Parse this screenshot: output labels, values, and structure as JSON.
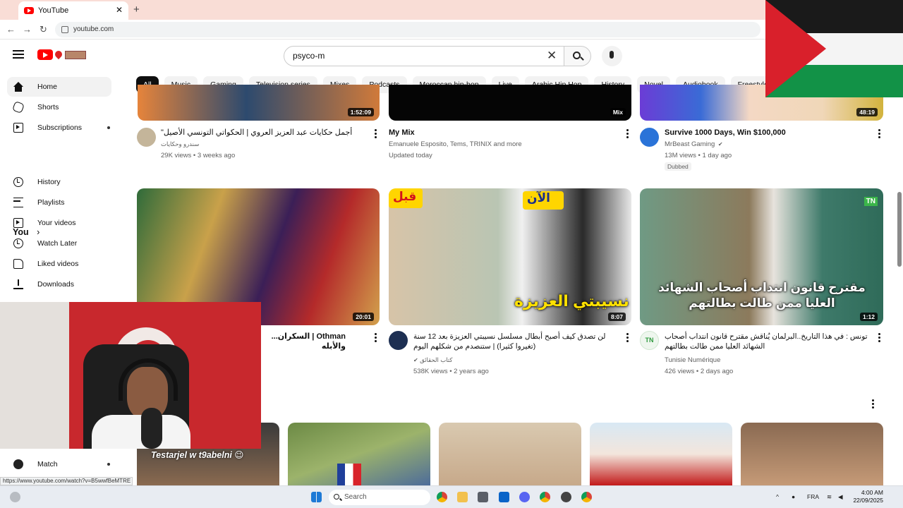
{
  "browser": {
    "tab_title": "YouTube",
    "tab_close": "✕",
    "new_tab": "+",
    "url": "youtube.com",
    "back": "←",
    "forward": "→",
    "reload": "↻"
  },
  "header": {
    "search_value": "psyco-m",
    "clear": "✕"
  },
  "chips": [
    "All",
    "Music",
    "Gaming",
    "Television series",
    "Mixes",
    "Podcasts",
    "Moroccan hip-hop",
    "Live",
    "Arabic Hip Hop",
    "History",
    "Novel",
    "Audiobook",
    "Freestyle Rap"
  ],
  "sidebar": {
    "items": [
      {
        "label": "Home"
      },
      {
        "label": "Shorts"
      },
      {
        "label": "Subscriptions"
      }
    ],
    "you_label": "You",
    "you_chevron": "›",
    "you_items": [
      {
        "label": "History"
      },
      {
        "label": "Playlists"
      },
      {
        "label": "Your videos"
      },
      {
        "label": "Watch Later"
      },
      {
        "label": "Liked videos"
      },
      {
        "label": "Downloads"
      }
    ],
    "match_label": "Match"
  },
  "row1": [
    {
      "title": "أجمل حكايات عبد العزيز العروي | الحكواتي التونسي الأصيل\"",
      "channel": "سندرو وحكايات",
      "stats": "29K views • 3 weeks ago",
      "duration": "1:52:09"
    },
    {
      "title": "My Mix",
      "channel": "Emanuele Esposito, Tems, TRINIX and more",
      "stats": "Updated today",
      "duration": "Mix"
    },
    {
      "title": "Survive 1000 Days, Win $100,000",
      "channel": "MrBeast Gaming",
      "verified": "✔",
      "stats": "13M views • 1 day ago",
      "badge": "Dubbed",
      "duration": "48:19"
    }
  ],
  "row2": [
    {
      "title": "Othman | السكران... والأبله",
      "duration": "20:01"
    },
    {
      "title": "لن تصدق كيف أصبح أبطال مسلسل نسيبتي العزيزة بعد 12 سنة (تغيروا كثيرا) | ستنصدم من شكلهم اليوم",
      "channel": "كتاب الحقائق",
      "verified": "✔",
      "stats": "538K views • 2 years ago",
      "duration": "8:07",
      "overlay_top_left": "قبل",
      "overlay_top_right": "الآن",
      "overlay_bottom": "نسيبتي العزيزة"
    },
    {
      "title": "تونس : في هذا التاريخ..البرلمان يُناقش مقترح قانون انتداب أصحاب الشهائد العليا ممن طالت بطالتهم",
      "channel": "Tunisie Numérique",
      "avatar_text": "TN",
      "stats": "426 views • 2 days ago",
      "duration": "1:12",
      "overlay_text": "مقترح قانون انتداب أصحاب الشهائد العليا ممن طالت بطالتهم",
      "overlay_logo": "TN"
    }
  ],
  "shorts": {
    "first_overlay": "Testarjel w t9abelni 😉"
  },
  "status_url": "https://www.youtube.com/watch?v=B5wwfBeMTRE",
  "taskbar": {
    "search": "Search",
    "lang": "FRA",
    "time": "4:00 AM",
    "date": "22/09/2025"
  },
  "colors": {
    "accent": "#ff0000",
    "chip_active": "#0f0f0f",
    "chip": "#f2f2f2",
    "tab_strip": "#f9ddd6"
  }
}
